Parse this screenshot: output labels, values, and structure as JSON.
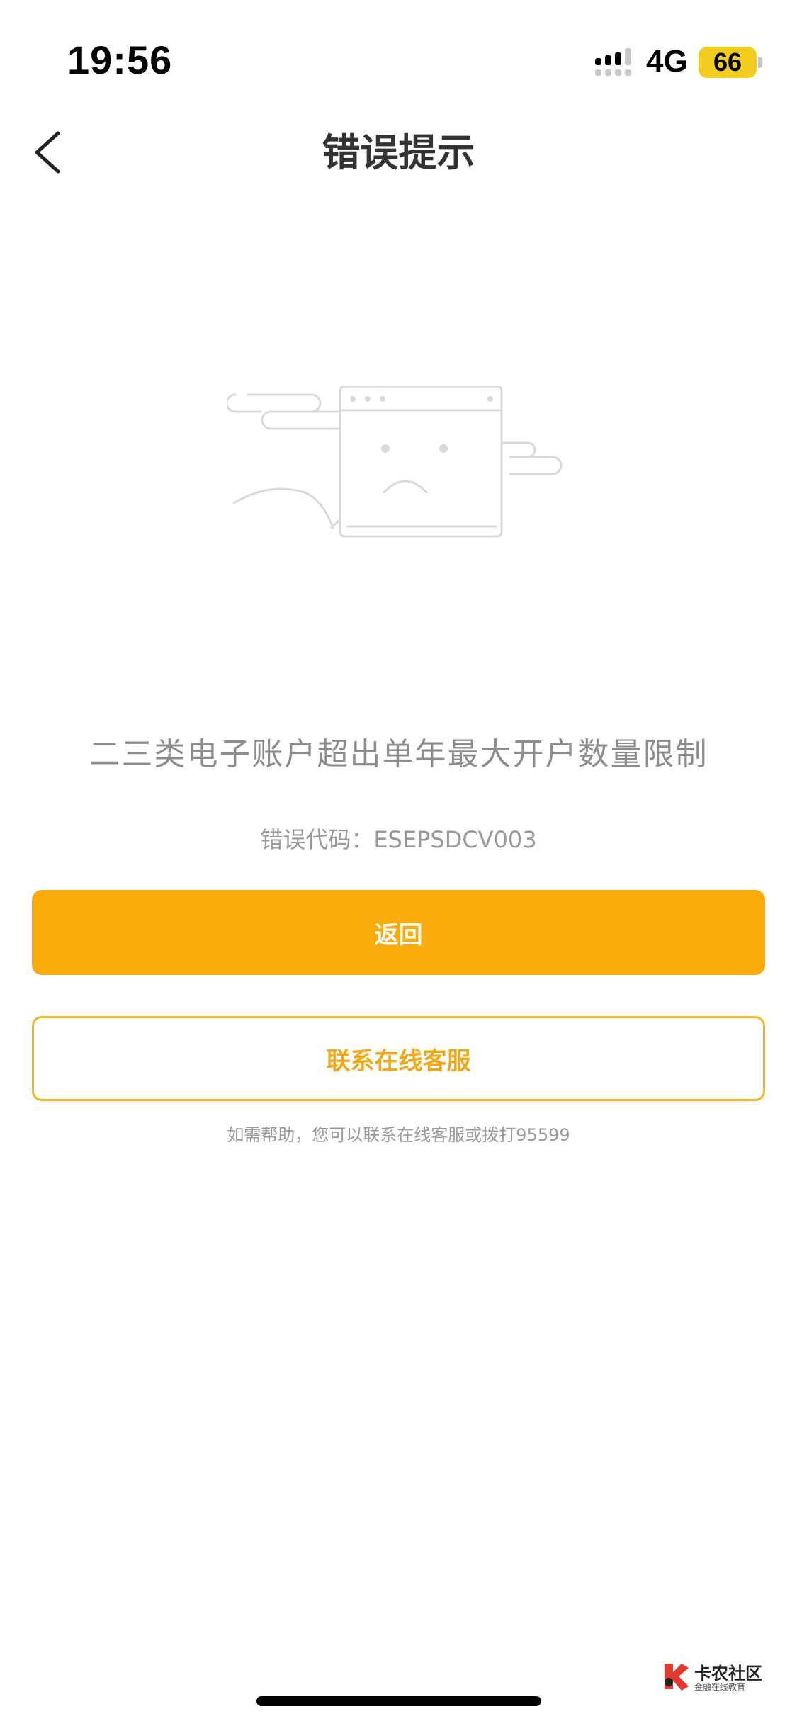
{
  "status_bar": {
    "time": "19:56",
    "network": "4G",
    "battery": "66"
  },
  "nav": {
    "title": "错误提示"
  },
  "error": {
    "message": "二三类电子账户超出单年最大开户数量限制",
    "code_text": "错误代码：ESEPSDCV003"
  },
  "actions": {
    "back_label": "返回",
    "contact_label": "联系在线客服"
  },
  "help": {
    "text": "如需帮助，您可以联系在线客服或拨打95599"
  },
  "watermark": {
    "title": "卡农社区",
    "subtitle": "金融在线教育"
  },
  "colors": {
    "primary": "#faab0c",
    "outline": "#f2b626",
    "battery": "#f2cc1f"
  }
}
